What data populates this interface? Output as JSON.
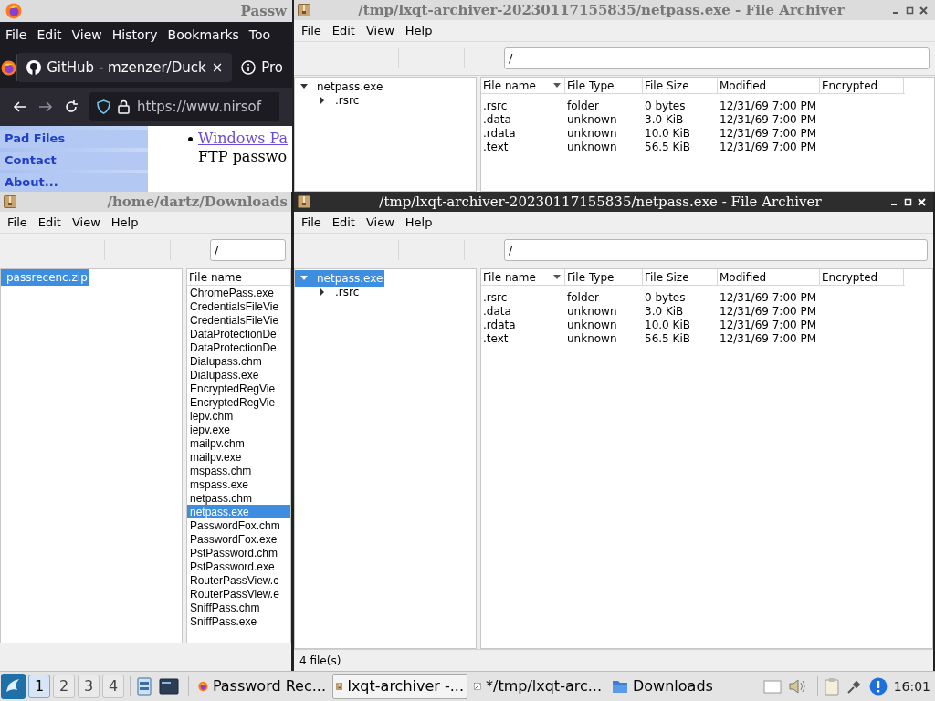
{
  "browser": {
    "title": "Passw",
    "menu": [
      "File",
      "Edit",
      "View",
      "History",
      "Bookmarks",
      "Too"
    ],
    "tabs": [
      {
        "label": "GitHub - mzenzer/Duck",
        "selected": true,
        "close": "×",
        "kind": "github"
      },
      {
        "label": "Pro",
        "selected": false,
        "kind": "info"
      }
    ],
    "url": "https://www.nirsof",
    "sidebar": [
      "Pad Files",
      "Contact",
      "About..."
    ],
    "link": "Windows Pa",
    "text": "FTP passwo"
  },
  "downloads_window": {
    "title": "/home/dartz/Downloads",
    "active": false,
    "menu": [
      "File",
      "Edit",
      "View",
      "Help"
    ],
    "path": "/",
    "tree": [
      {
        "label": "passrecenc.zip",
        "selected": true
      }
    ],
    "column": "File name",
    "files": [
      {
        "name": "ChromePass.exe",
        "selected": false
      },
      {
        "name": "CredentialsFileVie",
        "selected": false
      },
      {
        "name": "CredentialsFileVie",
        "selected": false
      },
      {
        "name": "DataProtectionDe",
        "selected": false
      },
      {
        "name": "DataProtectionDe",
        "selected": false
      },
      {
        "name": "Dialupass.chm",
        "selected": false
      },
      {
        "name": "Dialupass.exe",
        "selected": false
      },
      {
        "name": "EncryptedRegVie",
        "selected": false
      },
      {
        "name": "EncryptedRegVie",
        "selected": false
      },
      {
        "name": "iepv.chm",
        "selected": false
      },
      {
        "name": "iepv.exe",
        "selected": false
      },
      {
        "name": "mailpv.chm",
        "selected": false
      },
      {
        "name": "mailpv.exe",
        "selected": false
      },
      {
        "name": "mspass.chm",
        "selected": false
      },
      {
        "name": "mspass.exe",
        "selected": false
      },
      {
        "name": "netpass.chm",
        "selected": false
      },
      {
        "name": "netpass.exe",
        "selected": true
      },
      {
        "name": "PasswordFox.chm",
        "selected": false
      },
      {
        "name": "PasswordFox.exe",
        "selected": false
      },
      {
        "name": "PstPassword.chm",
        "selected": false
      },
      {
        "name": "PstPassword.exe",
        "selected": false
      },
      {
        "name": "RouterPassView.c",
        "selected": false
      },
      {
        "name": "RouterPassView.e",
        "selected": false
      },
      {
        "name": "SniffPass.chm",
        "selected": false
      },
      {
        "name": "SniffPass.exe",
        "selected": false
      }
    ]
  },
  "archivers": [
    {
      "title": "/tmp/lxqt-archiver-20230117155835/netpass.exe - File Archiver",
      "active": false,
      "menu": [
        "File",
        "Edit",
        "View",
        "Help"
      ],
      "path": "/",
      "tree": [
        {
          "label": "netpass.exe",
          "selected": false,
          "expanded": true,
          "children": [
            {
              "label": ".rsrc",
              "selected": false,
              "expanded": false
            }
          ]
        }
      ],
      "columns": [
        "File name",
        "File Type",
        "File Size",
        "Modified",
        "Encrypted"
      ],
      "rows": [
        [
          ".rsrc",
          "folder",
          "0 bytes",
          "12/31/69 7:00 PM"
        ],
        [
          ".data",
          "unknown",
          "3.0 KiB",
          "12/31/69 7:00 PM"
        ],
        [
          ".rdata",
          "unknown",
          "10.0 KiB",
          "12/31/69 7:00 PM"
        ],
        [
          ".text",
          "unknown",
          "56.5 KiB",
          "12/31/69 7:00 PM"
        ]
      ]
    },
    {
      "title": "/tmp/lxqt-archiver-20230117155835/netpass.exe - File Archiver",
      "active": true,
      "menu": [
        "File",
        "Edit",
        "View",
        "Help"
      ],
      "path": "/",
      "tree": [
        {
          "label": "netpass.exe",
          "selected": true,
          "expanded": true,
          "children": [
            {
              "label": ".rsrc",
              "selected": false,
              "expanded": false
            }
          ]
        }
      ],
      "columns": [
        "File name",
        "File Type",
        "File Size",
        "Modified",
        "Encrypted"
      ],
      "rows": [
        [
          ".rsrc",
          "folder",
          "0 bytes",
          "12/31/69 7:00 PM"
        ],
        [
          ".data",
          "unknown",
          "3.0 KiB",
          "12/31/69 7:00 PM"
        ],
        [
          ".rdata",
          "unknown",
          "10.0 KiB",
          "12/31/69 7:00 PM"
        ],
        [
          ".text",
          "unknown",
          "56.5 KiB",
          "12/31/69 7:00 PM"
        ]
      ],
      "status": "4 file(s)"
    }
  ],
  "taskbar": {
    "desktops": [
      {
        "label": "1",
        "selected": true
      },
      {
        "label": "2",
        "selected": false
      },
      {
        "label": "3",
        "selected": false
      },
      {
        "label": "4",
        "selected": false
      }
    ],
    "tasks": [
      {
        "label": "Password Rec...",
        "kind": "firefox",
        "selected": false
      },
      {
        "label": "lxqt-archiver -...",
        "kind": "archive",
        "selected": true
      },
      {
        "label": "*/tmp/lxqt-arc...",
        "kind": "editor",
        "selected": false
      },
      {
        "label": "Downloads",
        "kind": "folder",
        "selected": false
      }
    ],
    "clock": "16:01"
  }
}
